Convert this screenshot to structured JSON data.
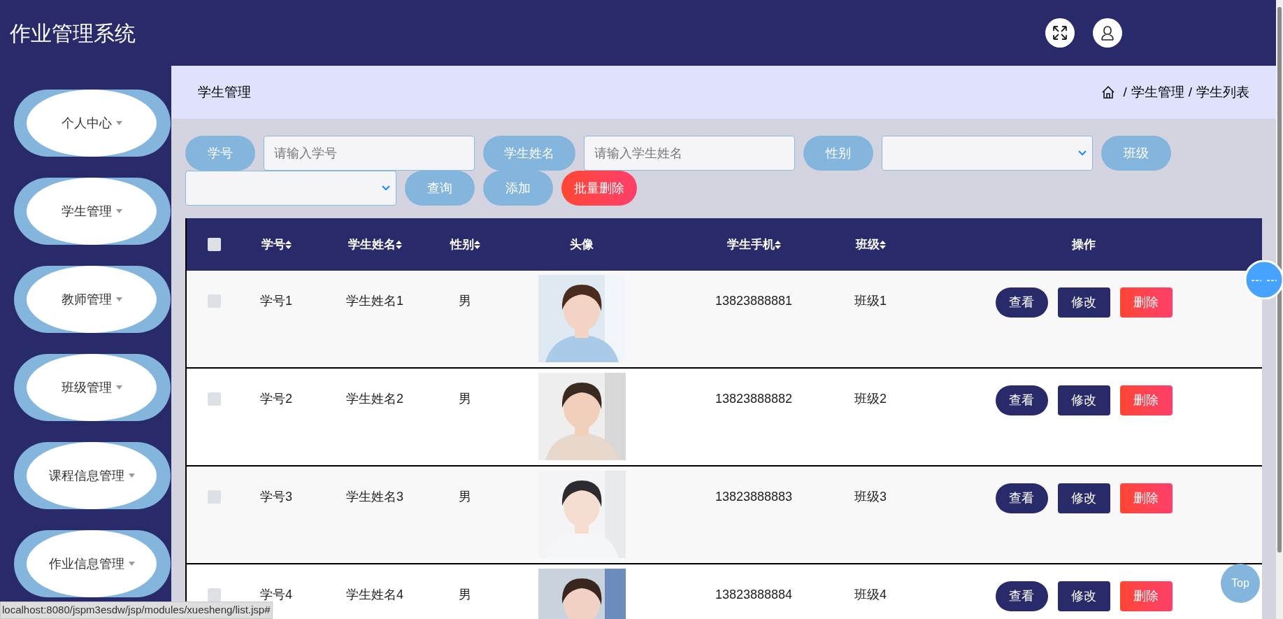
{
  "header": {
    "title": "作业管理系统"
  },
  "sidebar": {
    "items": [
      {
        "label": "个人中心"
      },
      {
        "label": "学生管理"
      },
      {
        "label": "教师管理"
      },
      {
        "label": "班级管理"
      },
      {
        "label": "课程信息管理"
      },
      {
        "label": "作业信息管理"
      }
    ]
  },
  "breadcrumb": {
    "title": "学生管理",
    "path": [
      {
        "separator": "/",
        "label": "学生管理"
      },
      {
        "separator": "/",
        "label": "学生列表"
      }
    ]
  },
  "filters": [
    {
      "kind": "label",
      "text": "学号"
    },
    {
      "kind": "input",
      "placeholder": "请输入学号"
    },
    {
      "kind": "label",
      "text": "学生姓名"
    },
    {
      "kind": "input",
      "placeholder": "请输入学生姓名"
    },
    {
      "kind": "label",
      "text": "性别"
    },
    {
      "kind": "select"
    },
    {
      "kind": "label",
      "text": "班级"
    },
    {
      "kind": "select"
    },
    {
      "kind": "button",
      "text": "查询"
    },
    {
      "kind": "button",
      "text": "添加"
    },
    {
      "kind": "danger",
      "text": "批量删除"
    }
  ],
  "table": {
    "select_all": {
      "checked": false
    },
    "columns": [
      {
        "label": "学号",
        "sortable": true
      },
      {
        "label": "学生姓名",
        "sortable": true
      },
      {
        "label": "性别",
        "sortable": true
      },
      {
        "label": "头像",
        "sortable": false
      },
      {
        "label": "学生手机",
        "sortable": true
      },
      {
        "label": "班级",
        "sortable": true
      },
      {
        "label": "操作",
        "sortable": false
      }
    ],
    "rows": [
      {
        "checked": false,
        "id": "学号1",
        "name": "学生姓名1",
        "gender": "男",
        "photo": {
          "kind": "picture"
        },
        "phone": "13823888881",
        "class_name": "班级1",
        "actions": [
          "查看",
          "修改",
          "删除"
        ]
      },
      {
        "checked": false,
        "id": "学号2",
        "name": "学生姓名2",
        "gender": "男",
        "photo": {
          "kind": "picture"
        },
        "phone": "13823888882",
        "class_name": "班级2",
        "actions": [
          "查看",
          "修改",
          "删除"
        ]
      },
      {
        "checked": false,
        "id": "学号3",
        "name": "学生姓名3",
        "gender": "男",
        "photo": {
          "kind": "picture"
        },
        "phone": "13823888883",
        "class_name": "班级3",
        "actions": [
          "查看",
          "修改",
          "删除"
        ]
      },
      {
        "checked": false,
        "id": "学号4",
        "name": "学生姓名4",
        "gender": "男",
        "photo": {
          "kind": "picture"
        },
        "phone": "13823888884",
        "class_name": "班级4",
        "actions": [
          "查看",
          "修改",
          "删除"
        ]
      }
    ]
  },
  "back_to_top": {
    "label": "Top"
  },
  "status_bar": {
    "url": "localhost:8080/jspm3esdw/jsp/modules/xuesheng/list.jsp#"
  }
}
